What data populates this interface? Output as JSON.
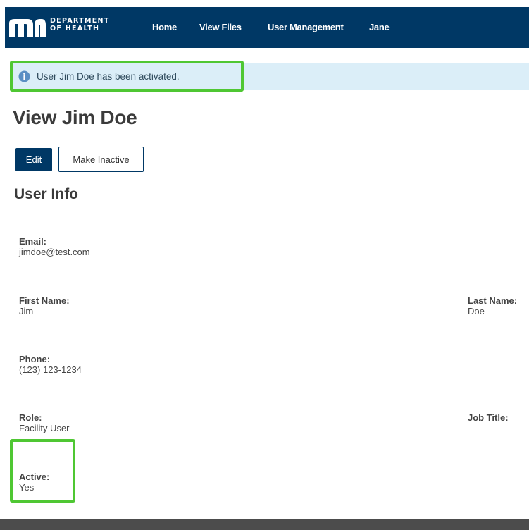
{
  "header": {
    "logo_line1": "DEPARTMENT",
    "logo_line2": "OF HEALTH",
    "nav": {
      "home": "Home",
      "view_files": "View Files",
      "user_management": "User Management",
      "user": "Jane"
    }
  },
  "alert": {
    "message": "User Jim Doe has been activated."
  },
  "page": {
    "title": "View Jim Doe",
    "edit_label": "Edit",
    "make_inactive_label": "Make Inactive",
    "section_title": "User Info"
  },
  "fields": {
    "email_label": "Email:",
    "email_value": "jimdoe@test.com",
    "first_name_label": "First Name:",
    "first_name_value": "Jim",
    "last_name_label": "Last Name:",
    "last_name_value": "Doe",
    "phone_label": "Phone:",
    "phone_value": "(123) 123-1234",
    "role_label": "Role:",
    "role_value": "Facility User",
    "job_title_label": "Job Title:",
    "active_label": "Active:",
    "active_value": "Yes"
  },
  "colors": {
    "nav_bg": "#003865",
    "alert_bg": "#dbeef8",
    "highlight": "#4fc733",
    "footer_bg": "#4c4c4c"
  }
}
